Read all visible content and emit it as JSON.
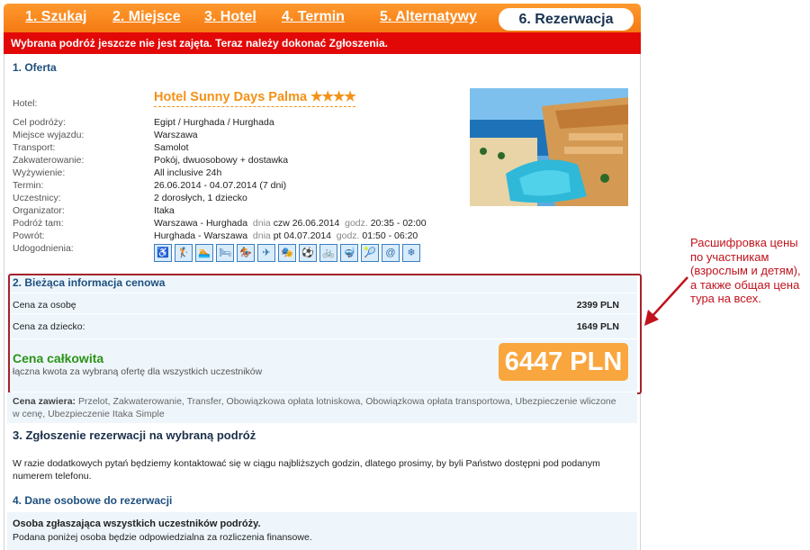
{
  "tabs": [
    {
      "label": "1. Szukaj"
    },
    {
      "label": "2. Miejsce"
    },
    {
      "label": "3. Hotel"
    },
    {
      "label": "4. Termin"
    },
    {
      "label": "5. Alternatywy"
    },
    {
      "label": "6. Rezerwacja"
    }
  ],
  "alert": "Wybrana podróż jeszcze nie jest zajęta. Teraz należy dokonać Zgłoszenia.",
  "offer": {
    "title": "1. Oferta",
    "hotel_label": "Hotel:",
    "hotel_name": "Hotel Sunny Days Palma",
    "stars": "★★★★",
    "destination_label": "Cel podróży:",
    "destination": "Egipt / Hurghada / Hurghada",
    "departure_label": "Miejsce wyjazdu:",
    "departure": "Warszawa",
    "transport_label": "Transport:",
    "transport": "Samolot",
    "accommodation_label": "Zakwaterowanie:",
    "accommodation": "Pokój, dwuosobowy + dostawka",
    "board_label": "Wyżywienie:",
    "board": "All inclusive 24h",
    "dates_label": "Termin:",
    "dates": "26.06.2014 - 04.07.2014 (7 dni)",
    "participants_label": "Uczestnicy:",
    "participants": "2 dorosłych, 1  dziecko",
    "organizer_label": "Organizator:",
    "organizer": "Itaka",
    "outbound_label": "Podróż tam:",
    "outbound_route": "Warszawa - Hurghada",
    "outbound_day_label": "dnia",
    "outbound_day": "czw 26.06.2014",
    "outbound_time_label": "godz.",
    "outbound_time": "20:35 - 02:00",
    "return_label": "Powrót:",
    "return_route": "Hurghada - Warszawa",
    "return_day_label": "dnia",
    "return_day": "pt 04.07.2014",
    "return_time_label": "godz.",
    "return_time": "01:50 - 06:20",
    "amenities_label": "Udogodnienia:",
    "amenities": [
      "♿",
      "🏌",
      "🏊",
      "🛏",
      "🏇",
      "✈",
      "🎭",
      "⚽",
      "🚲",
      "🤿",
      "🎾",
      "@",
      "❄"
    ]
  },
  "pricing": {
    "title": "2. Bieżąca informacja cenowa",
    "adult_label": "Cena za osobę",
    "adult_price": "2399 PLN",
    "child_label": "Cena za dziecko:",
    "child_price": "1649 PLN",
    "total_label": "Cena całkowita",
    "total_sub": "łączna kwota za wybraną ofertę dla wszystkich uczestników",
    "total_price": "6447 PLN"
  },
  "includes": {
    "label": "Cena zawiera:",
    "text": "Przelot, Zakwaterowanie, Transfer, Obowiązkowa opłata lotniskowa, Obowiązkowa opłata transportowa, Ubezpieczenie wliczone w cenę, Ubezpieczenie Itaka Simple"
  },
  "section3": {
    "title": "3. Zgłoszenie rezerwacji na wybraną podróż",
    "text": "W razie dodatkowych pytań będziemy kontaktować się w ciągu najbliższych godzin, dlatego prosimy, by byli Państwo dostępni pod podanym numerem telefonu."
  },
  "section4": {
    "title": "4. Dane osobowe do rezerwacji",
    "subtitle": "Osoba zgłaszająca wszystkich uczestników podróży.",
    "text": "Podana poniżej osoba będzie odpowiedzialna za rozliczenia finansowe."
  },
  "annotation": "Расшифровка цены по участникам (взрослым и детям), а также общая цена тура на всех.",
  "colors": {
    "accent": "#f47a12",
    "alert": "#e30808",
    "total": "#f9a63e",
    "annotation": "#c0131d"
  }
}
